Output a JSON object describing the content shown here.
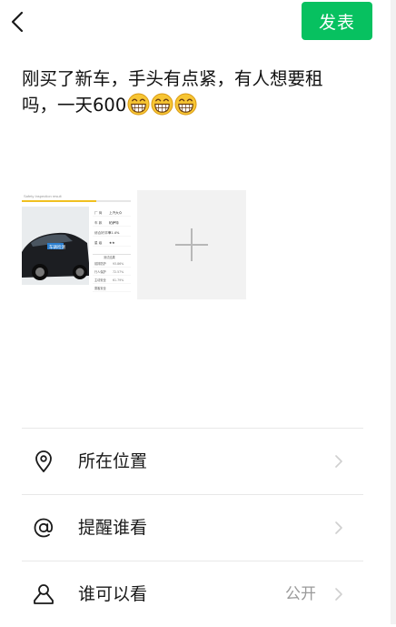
{
  "header": {
    "publish_label": "发表",
    "accent": "#07c160"
  },
  "post": {
    "text": "刚买了新车，手头有点紧，有人想要租吗，一天600",
    "emoji_name": "grinning-face-emoji",
    "emoji_count": 3
  },
  "photo": {
    "header_text": "Safety Inspection result",
    "table": [
      [
        "厂 商",
        "上汽大众"
      ],
      [
        "车 款",
        "帕萨特"
      ],
      [
        "综合好评率",
        "91.4%"
      ],
      [
        "星 级",
        "★★"
      ]
    ],
    "subtable_title": "测试结果",
    "subtable": [
      [
        "前排防护",
        "93.86%"
      ],
      [
        "行人保护",
        "72.57%"
      ],
      [
        "主动安全",
        "61.79%"
      ],
      [
        "乘客安全",
        ""
      ]
    ],
    "banner_text": "车辆检测"
  },
  "options": [
    {
      "icon": "location-pin-icon",
      "label": "所在位置",
      "value": ""
    },
    {
      "icon": "at-sign-icon",
      "label": "提醒谁看",
      "value": ""
    },
    {
      "icon": "person-icon",
      "label": "谁可以看",
      "value": "公开"
    }
  ]
}
